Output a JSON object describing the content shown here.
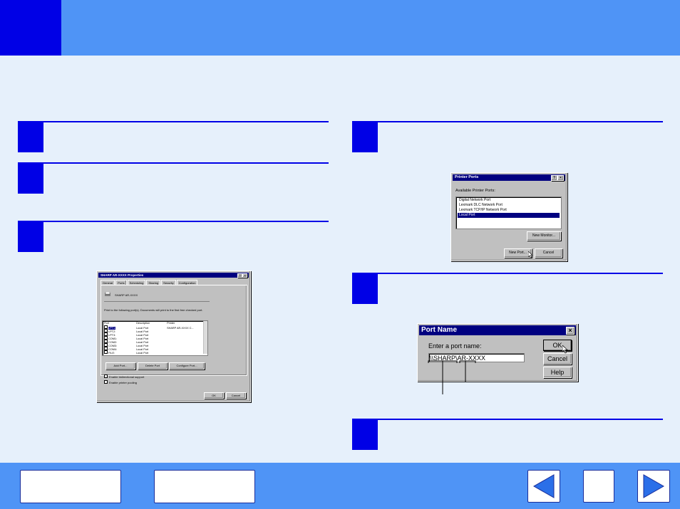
{
  "printer_properties": {
    "title": "SHARP AR-XXXX Properties",
    "tabs": [
      "General",
      "Ports",
      "Scheduling",
      "Sharing",
      "Security",
      "Configuration"
    ],
    "printer_name": "SHARP AR-XXXX",
    "print_to_text": "Print to the following port(s). Documents will print to the first free checked port.",
    "columns": [
      "Port",
      "Description",
      "Printer"
    ],
    "rows": [
      {
        "port": "LPT1:",
        "description": "Local Port",
        "printer": "SHARP AR-XXXX C..."
      },
      {
        "port": "LPT2:",
        "description": "Local Port",
        "printer": ""
      },
      {
        "port": "LPT3:",
        "description": "Local Port",
        "printer": ""
      },
      {
        "port": "COM1:",
        "description": "Local Port",
        "printer": ""
      },
      {
        "port": "COM2:",
        "description": "Local Port",
        "printer": ""
      },
      {
        "port": "COM3:",
        "description": "Local Port",
        "printer": ""
      },
      {
        "port": "COM4:",
        "description": "Local Port",
        "printer": ""
      },
      {
        "port": "FILE:",
        "description": "Local Port",
        "printer": ""
      }
    ],
    "add_port": "Add Port...",
    "delete_port": "Delete Port",
    "configure_port": "Configure Port...",
    "bidirectional": "Enable bidirectional support",
    "pooling": "Enable printer pooling",
    "ok": "OK",
    "cancel": "Cancel"
  },
  "printer_ports": {
    "title": "Printer Ports",
    "available_label": "Available Printer Ports:",
    "items": [
      "Digital Network Port",
      "Lexmark DLC Network Port",
      "Lexmark TCP/IP Network Port",
      "Local Port"
    ],
    "new_monitor": "New Monitor...",
    "new_port": "New Port...",
    "cancel": "Cancel"
  },
  "port_name": {
    "title": "Port Name",
    "prompt": "Enter a port name:",
    "value": "\\\\SHARP\\AR-XXXX",
    "ok": "OK",
    "cancel": "Cancel",
    "help": "Help"
  },
  "colors": {
    "header_blue": "#4f94f6",
    "step_blue": "#0000e6",
    "content_bg": "#e6f0fb"
  }
}
